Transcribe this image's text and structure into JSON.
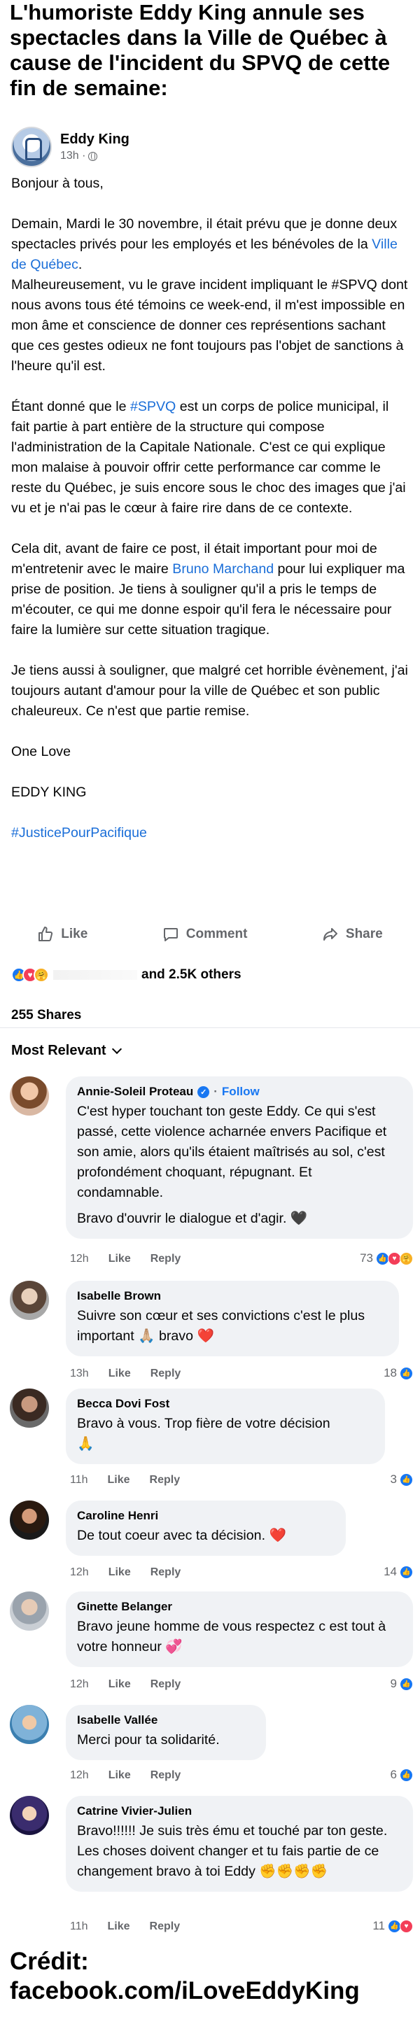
{
  "headline": "L'humoriste Eddy King annule ses spectacles dans la Ville de Québec à cause de l'incident du SPVQ de cette fin de semaine:",
  "post": {
    "author": "Eddy King",
    "time": "13h ·",
    "greeting": "Bonjour à tous,",
    "p1_a": "Demain, Mardi le 30 novembre, il était prévu que je donne deux spectacles privés pour les employés et les bénévoles de la ",
    "p1_link": "Ville de Québec",
    "p1_b": ".",
    "p1_c": "Malheureusement, vu le grave incident impliquant le #SPVQ  dont nous avons tous été témoins ce week-end, il m'est impossible en mon âme et conscience de donner ces représentions sachant que ces gestes odieux ne font toujours pas l'objet de sanctions à l'heure qu'il est.",
    "p2_a": "Étant donné que le ",
    "p2_link": "#SPVQ",
    "p2_b": " est un corps de police municipal, il fait partie à part entière de la structure qui compose l'administration de la Capitale Nationale. C'est ce qui explique mon malaise à pouvoir offrir cette performance car comme le reste du Québec, je suis encore sous le choc des images que j'ai vu et je n'ai pas le cœur à faire rire dans de ce contexte.",
    "p3_a": "Cela dit, avant de faire ce post, il était important pour moi de m'entretenir avec le maire ",
    "p3_link": "Bruno Marchand",
    "p3_b": " pour lui expliquer ma prise de position. Je tiens à souligner qu'il a pris le temps de m'écouter, ce qui me donne espoir qu'il fera le nécessaire pour faire la lumière sur cette situation tragique.",
    "p4": "Je tiens aussi à souligner, que malgré cet horrible évènement, j'ai toujours autant d'amour pour la ville de Québec et son public chaleureux. Ce n'est que partie remise.",
    "p5": "One Love",
    "p6": "EDDY KING",
    "hashtag": "#JusticePourPacifique"
  },
  "actions": {
    "like": "Like",
    "comment": "Comment",
    "share": "Share"
  },
  "reactions": {
    "summary": "and 2.5K others",
    "shares": "255 Shares"
  },
  "sort_label": "Most Relevant",
  "comments": [
    {
      "name": "Annie-Soleil Proteau",
      "follow": "Follow",
      "text": "C'est hyper touchant ton geste Eddy. Ce qui s'est passé, cette violence acharnée envers Pacifique et son amie, alors qu'ils étaient maîtrisés au sol, c'est profondément choquant, répugnant. Et condamnable.",
      "text2": "Bravo d'ouvrir le dialogue et d'agir.",
      "emoji": "🖤",
      "time": "12h",
      "like": "Like",
      "reply": "Reply",
      "count": "73"
    },
    {
      "name": "Isabelle Brown",
      "text": "Suivre son cœur et ses convictions c'est le plus important 🙏🏼 bravo",
      "emoji": "❤️",
      "time": "13h",
      "like": "Like",
      "reply": "Reply",
      "count": "18"
    },
    {
      "name": "Becca Dovi Fost",
      "text": "Bravo à vous. Trop fière de votre décision",
      "emoji": "🙏",
      "time": "11h",
      "like": "Like",
      "reply": "Reply",
      "count": "3"
    },
    {
      "name": "Caroline Henri",
      "text": "De tout coeur avec ta décision.",
      "emoji": "❤️",
      "time": "12h",
      "like": "Like",
      "reply": "Reply",
      "count": "14"
    },
    {
      "name": "Ginette Belanger",
      "text": "Bravo jeune homme de vous respectez c est tout à votre honneur",
      "emoji": "💞",
      "time": "12h",
      "like": "Like",
      "reply": "Reply",
      "count": "9"
    },
    {
      "name": "Isabelle Vallée",
      "text": "Merci pour ta solidarité.",
      "time": "12h",
      "like": "Like",
      "reply": "Reply",
      "count": "6"
    },
    {
      "name": "Catrine Vivier-Julien",
      "text": "Bravo!!!!!! Je suis très ému et touché par ton geste. Les choses doivent changer et tu fais partie de ce changement bravo à toi Eddy",
      "emoji": "✊✊✊✊",
      "time": "11h",
      "like": "Like",
      "reply": "Reply",
      "count": "11"
    }
  ],
  "credit": {
    "line1": "Crédit:",
    "line2": "facebook.com/iLoveEddyKing"
  }
}
